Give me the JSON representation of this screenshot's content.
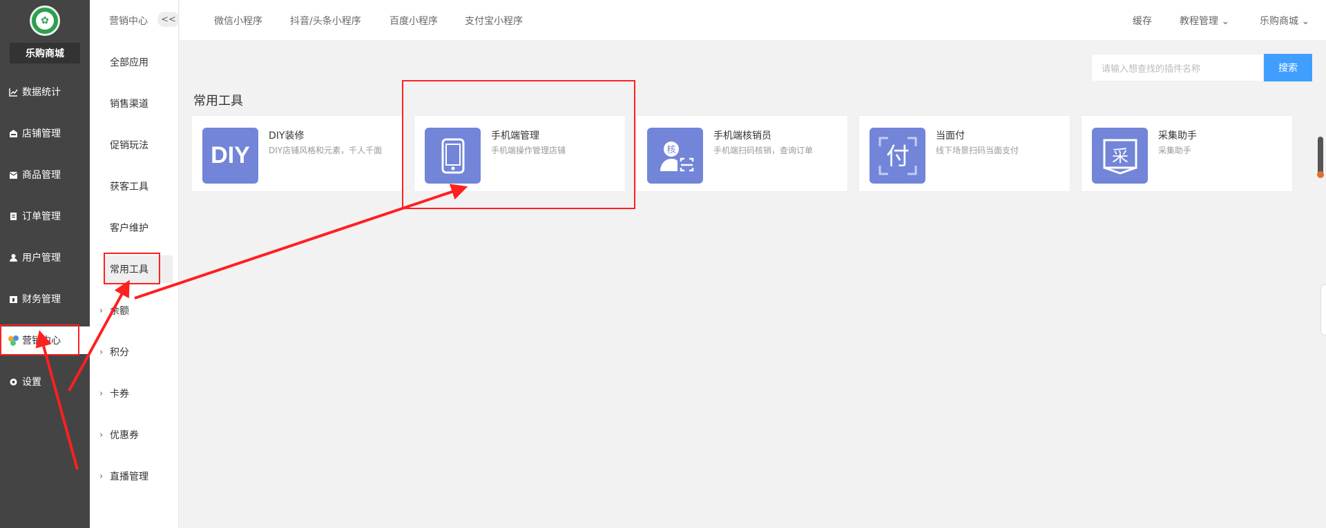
{
  "sidebar": {
    "shop_name": "乐购商城",
    "items": [
      {
        "label": "数据统计",
        "icon": "chart-line-icon"
      },
      {
        "label": "店铺管理",
        "icon": "store-icon"
      },
      {
        "label": "商品管理",
        "icon": "package-icon"
      },
      {
        "label": "订单管理",
        "icon": "clipboard-icon"
      },
      {
        "label": "用户管理",
        "icon": "user-icon"
      },
      {
        "label": "财务管理",
        "icon": "wallet-icon"
      },
      {
        "label": "营销中心",
        "icon": "marketing-icon"
      },
      {
        "label": "设置",
        "icon": "gear-icon"
      }
    ]
  },
  "subnav": {
    "title": "营销中心",
    "collapse_label": "<<",
    "items": [
      {
        "label": "全部应用"
      },
      {
        "label": "销售渠道"
      },
      {
        "label": "促销玩法"
      },
      {
        "label": "获客工具"
      },
      {
        "label": "客户维护"
      },
      {
        "label": "常用工具"
      },
      {
        "label": "余额"
      },
      {
        "label": "积分"
      },
      {
        "label": "卡券"
      },
      {
        "label": "优惠券"
      },
      {
        "label": "直播管理"
      }
    ]
  },
  "topbar": {
    "tabs": [
      "微信小程序",
      "抖音/头条小程序",
      "百度小程序",
      "支付宝小程序"
    ],
    "cache": "缓存",
    "tutorial": "教程管理",
    "shop": "乐购商城"
  },
  "search": {
    "placeholder": "请输入想查找的插件名称",
    "button": "搜索"
  },
  "section_title": "常用工具",
  "cards": [
    {
      "name": "DIY装修",
      "desc": "DIY店铺风格和元素，千人千面",
      "icon_text": "DIY",
      "icon": "diy-icon"
    },
    {
      "name": "手机端管理",
      "desc": "手机端操作管理店铺",
      "icon_text": "",
      "icon": "mobile-phone-icon"
    },
    {
      "name": "手机端核销员",
      "desc": "手机端扫码核销，查询订单",
      "icon_text": "核",
      "icon": "verify-user-icon"
    },
    {
      "name": "当面付",
      "desc": "线下场景扫码当面支付",
      "icon_text": "付",
      "icon": "pay-icon"
    },
    {
      "name": "采集助手",
      "desc": "采集助手",
      "icon_text": "采",
      "icon": "collect-icon"
    }
  ],
  "colors": {
    "sidebar_bg": "#444444",
    "accent_blue": "#409eff",
    "card_icon": "#7285d9",
    "highlight_red": "#ff2020"
  }
}
